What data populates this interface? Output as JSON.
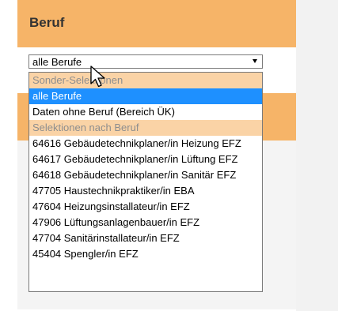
{
  "panel": {
    "title": "Beruf"
  },
  "select": {
    "value": "alle Berufe"
  },
  "dropdown": {
    "options": [
      {
        "label": "Sonder-Selektionen",
        "kind": "group"
      },
      {
        "label": "alle Berufe",
        "kind": "selected"
      },
      {
        "label": "Daten ohne Beruf (Bereich ÜK)",
        "kind": "option"
      },
      {
        "label": "Selektionen nach Beruf",
        "kind": "group"
      },
      {
        "label": "64616 Gebäudetechnikplaner/in Heizung EFZ",
        "kind": "option"
      },
      {
        "label": "64617 Gebäudetechnikplaner/in Lüftung EFZ",
        "kind": "option"
      },
      {
        "label": "64618 Gebäudetechnikplaner/in Sanitär EFZ",
        "kind": "option"
      },
      {
        "label": "47705 Haustechnikpraktiker/in EBA",
        "kind": "option"
      },
      {
        "label": "47604 Heizungsinstallateur/in EFZ",
        "kind": "option"
      },
      {
        "label": "47906 Lüftungsanlagenbauer/in EFZ",
        "kind": "option"
      },
      {
        "label": "47704 Sanitärinstallateur/in EFZ",
        "kind": "option"
      },
      {
        "label": "45404 Spengler/in EFZ",
        "kind": "option"
      }
    ]
  },
  "icons": {
    "pointer": "mouse-pointer-icon",
    "dropdown_arrow": "triangle-down-icon"
  },
  "colors": {
    "header_orange": "#f6b468",
    "group_row": "#fad3a6",
    "selected_row": "#1e90ff"
  }
}
